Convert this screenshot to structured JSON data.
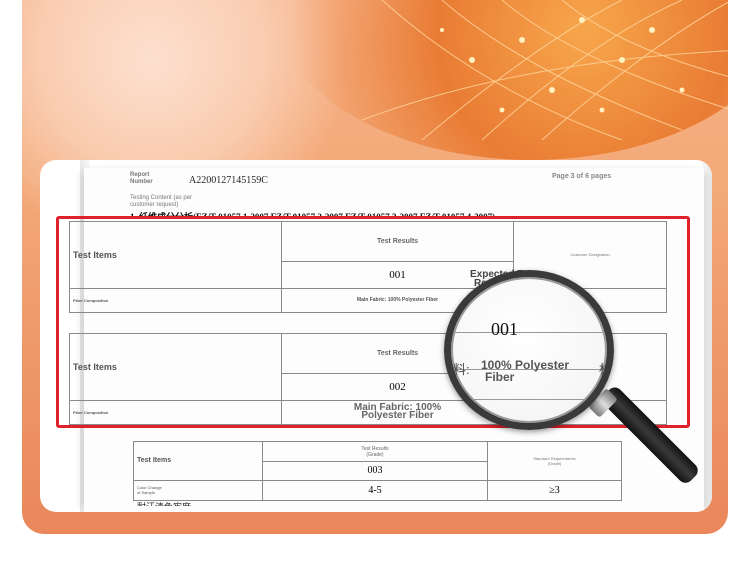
{
  "report": {
    "label": "Report\nNumber",
    "number": "A2200127145159C",
    "page": "Page 3 of 6 pages",
    "testing_content": "Testing Content (as per\ncustomer request)",
    "section_title": "1.   纤维成分分析(FZ/T 01057.1-2007 FZ/T 01057.2-2007 FZ/T 01057.3-2007 FZ/T 01057.4-2007)"
  },
  "table1": {
    "test_items": "Test Items",
    "test_results": "Test Results",
    "customer_designation": "Customer Designation",
    "sample_id": "001",
    "row_label": "Fiber Composition",
    "result": "Main Fabric: 100% Polyester Fiber"
  },
  "table2": {
    "test_items": "Test Items",
    "test_results": "Test Results",
    "sample_id": "002",
    "row_label": "Fiber Composition",
    "result_zoom_line1": "Main Fabric: 100%",
    "result_zoom_line2": "Polyester Fiber"
  },
  "table3": {
    "test_items": "Test Items",
    "test_results": "Test Results\n(Grade)",
    "standard": "Standard Requirements\n(Grade)",
    "sample_id": "003",
    "row_label": "Color Change\nof Sample",
    "result": "4-5",
    "requirement": "≥3",
    "next_row": "耐汗渍色牢度"
  },
  "magnifier": {
    "expected_line1": "Expected Test",
    "expected_line2": "Results",
    "sample_id": "001",
    "fiber_line1": "100% Polyester",
    "fiber_line2": "Fiber",
    "left_char": "料:",
    "right_char": "标"
  },
  "colors": {
    "highlight": "#e0202a",
    "background_top": "#f6b38a",
    "background_bottom": "#e9875a"
  }
}
